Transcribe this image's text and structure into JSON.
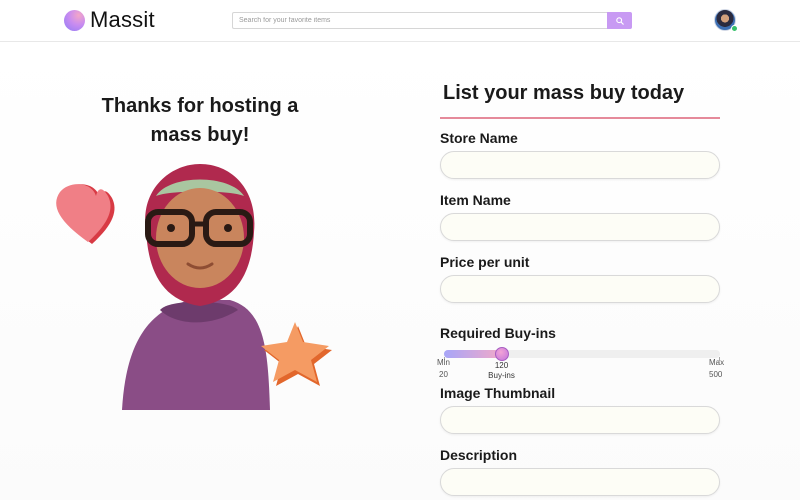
{
  "header": {
    "brand": "Massit",
    "search_placeholder": "Search for your favorite items",
    "search_icon": "search-icon",
    "avatar": "user-avatar"
  },
  "left": {
    "heading": "Thanks for hosting a mass buy!"
  },
  "form": {
    "title": "List your mass buy today",
    "fields": {
      "store_name": {
        "label": "Store Name",
        "value": ""
      },
      "item_name": {
        "label": "Item Name",
        "value": ""
      },
      "price_per_unit": {
        "label": "Price per unit",
        "value": ""
      },
      "image_thumbnail": {
        "label": "Image Thumbnail",
        "value": ""
      },
      "description": {
        "label": "Description",
        "value": ""
      }
    },
    "buyins": {
      "label": "Required Buy-ins",
      "min_label": "Min",
      "max_label": "Max",
      "min": "20",
      "max": "500",
      "current": "120",
      "current_caption": "Buy-ins"
    }
  },
  "colors": {
    "accent": "#c89af3",
    "title_rule": "#e58a9a",
    "field_bg": "#fdfdf6",
    "status_online": "#36c06a"
  }
}
